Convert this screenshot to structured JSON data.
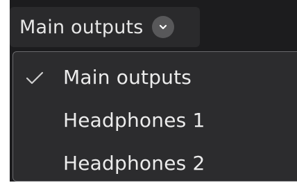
{
  "dropdown": {
    "selected_label": "Main outputs",
    "toggle_icon": "chevron-down-icon",
    "options": [
      {
        "label": "Main outputs",
        "selected": true
      },
      {
        "label": "Headphones 1",
        "selected": false
      },
      {
        "label": "Headphones 2",
        "selected": false
      }
    ]
  },
  "colors": {
    "background": "#1c1c1e",
    "menu_background": "#2c2c2e",
    "menu_border": "#6a6a6d",
    "text": "#ececec",
    "badge": "#58585a"
  }
}
